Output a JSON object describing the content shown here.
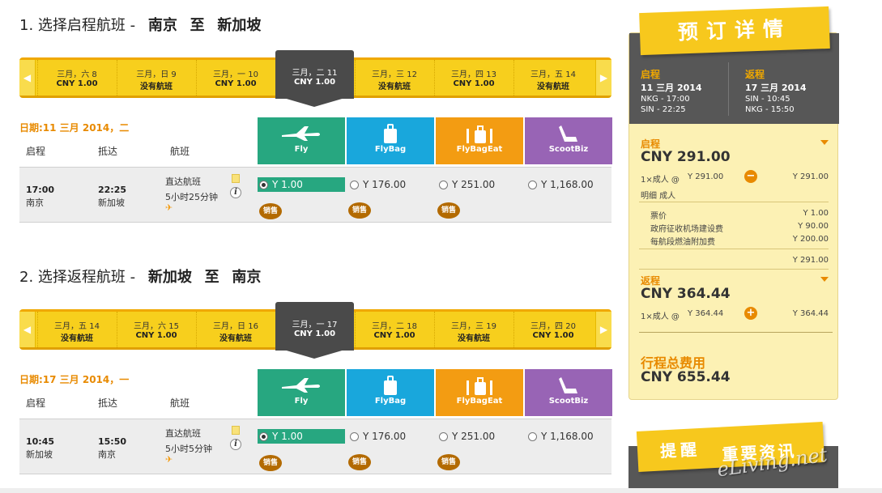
{
  "outbound": {
    "step": "1.",
    "title_label": "选择启程航班 -",
    "from": "南京",
    "to_word": "至",
    "to": "新加坡",
    "dates": [
      {
        "date": "三月，六 8",
        "price": "CNY 1.00"
      },
      {
        "date": "三月，日 9",
        "price": "没有航班"
      },
      {
        "date": "三月，一 10",
        "price": "CNY 1.00"
      },
      {
        "date": "三月，二 11",
        "price": "CNY 1.00",
        "selected": true
      },
      {
        "date": "三月，三 12",
        "price": "没有航班"
      },
      {
        "date": "三月，四 13",
        "price": "CNY 1.00"
      },
      {
        "date": "三月，五 14",
        "price": "没有航班"
      }
    ],
    "date_label": "日期:11 三月 2014，二",
    "flight": {
      "depart_time": "17:00",
      "depart_city": "南京",
      "arrive_time": "22:25",
      "arrive_city": "新加坡",
      "type": "直达航班",
      "duration": "5小时25分钟",
      "fares": [
        "Y 1.00",
        "Y 176.00",
        "Y 251.00",
        "Y 1,168.00"
      ]
    }
  },
  "return": {
    "step": "2.",
    "title_label": "选择返程航班 -",
    "from": "新加坡",
    "to_word": "至",
    "to": "南京",
    "dates": [
      {
        "date": "三月，五 14",
        "price": "没有航班"
      },
      {
        "date": "三月，六 15",
        "price": "CNY 1.00"
      },
      {
        "date": "三月，日 16",
        "price": "没有航班"
      },
      {
        "date": "三月，一 17",
        "price": "CNY 1.00",
        "selected": true
      },
      {
        "date": "三月，二 18",
        "price": "CNY 1.00"
      },
      {
        "date": "三月，三 19",
        "price": "没有航班"
      },
      {
        "date": "三月，四 20",
        "price": "CNY 1.00"
      }
    ],
    "date_label": "日期:17 三月 2014，一",
    "flight": {
      "depart_time": "10:45",
      "depart_city": "新加坡",
      "arrive_time": "15:50",
      "arrive_city": "南京",
      "type": "直达航班",
      "duration": "5小时5分钟",
      "fares": [
        "Y 1.00",
        "Y 176.00",
        "Y 251.00",
        "Y 1,168.00"
      ]
    }
  },
  "columns": {
    "depart": "启程",
    "arrive": "抵达",
    "flight": "航班"
  },
  "fare_types": [
    "Fly",
    "FlyBag",
    "FlyBagEat",
    "ScootBiz"
  ],
  "sale_badge": "销售",
  "summary": {
    "banner": "预订详情",
    "outbound": {
      "label": "启程",
      "date": "11 三月 2014",
      "line1": "NKG - 17:00",
      "line2": "SIN - 22:25"
    },
    "return": {
      "label": "返程",
      "date": "17 三月 2014",
      "line1": "SIN - 10:45",
      "line2": "NKG - 15:50"
    },
    "out_section": {
      "label": "启程",
      "total": "CNY 291.00",
      "pax": "1×成人 @",
      "pax_price": "Y 291.00",
      "pax_total": "Y 291.00",
      "detail_label": "明细 成人",
      "items": [
        {
          "name": "票价",
          "value": "Y 1.00"
        },
        {
          "name": "政府征收机场建设费",
          "value": "Y 90.00"
        },
        {
          "name": "每航段燃油附加费",
          "value": "Y 200.00"
        }
      ],
      "subtotal": "Y 291.00"
    },
    "ret_section": {
      "label": "返程",
      "total": "CNY 364.44",
      "pax": "1×成人 @",
      "pax_price": "Y 364.44",
      "pax_total": "Y 364.44"
    },
    "grand_label": "行程总费用",
    "grand_total": "CNY 655.44"
  },
  "reminder": {
    "title": "提醒",
    "subtitle": "重要资讯"
  },
  "watermark": "eLiving.net",
  "colors": {
    "fly": "#27a780",
    "flybag": "#19a7dc",
    "flybageat": "#f39c12",
    "scootbiz": "#9864b5",
    "accent": "#e88a00",
    "datebar": "#f7cf1d"
  }
}
